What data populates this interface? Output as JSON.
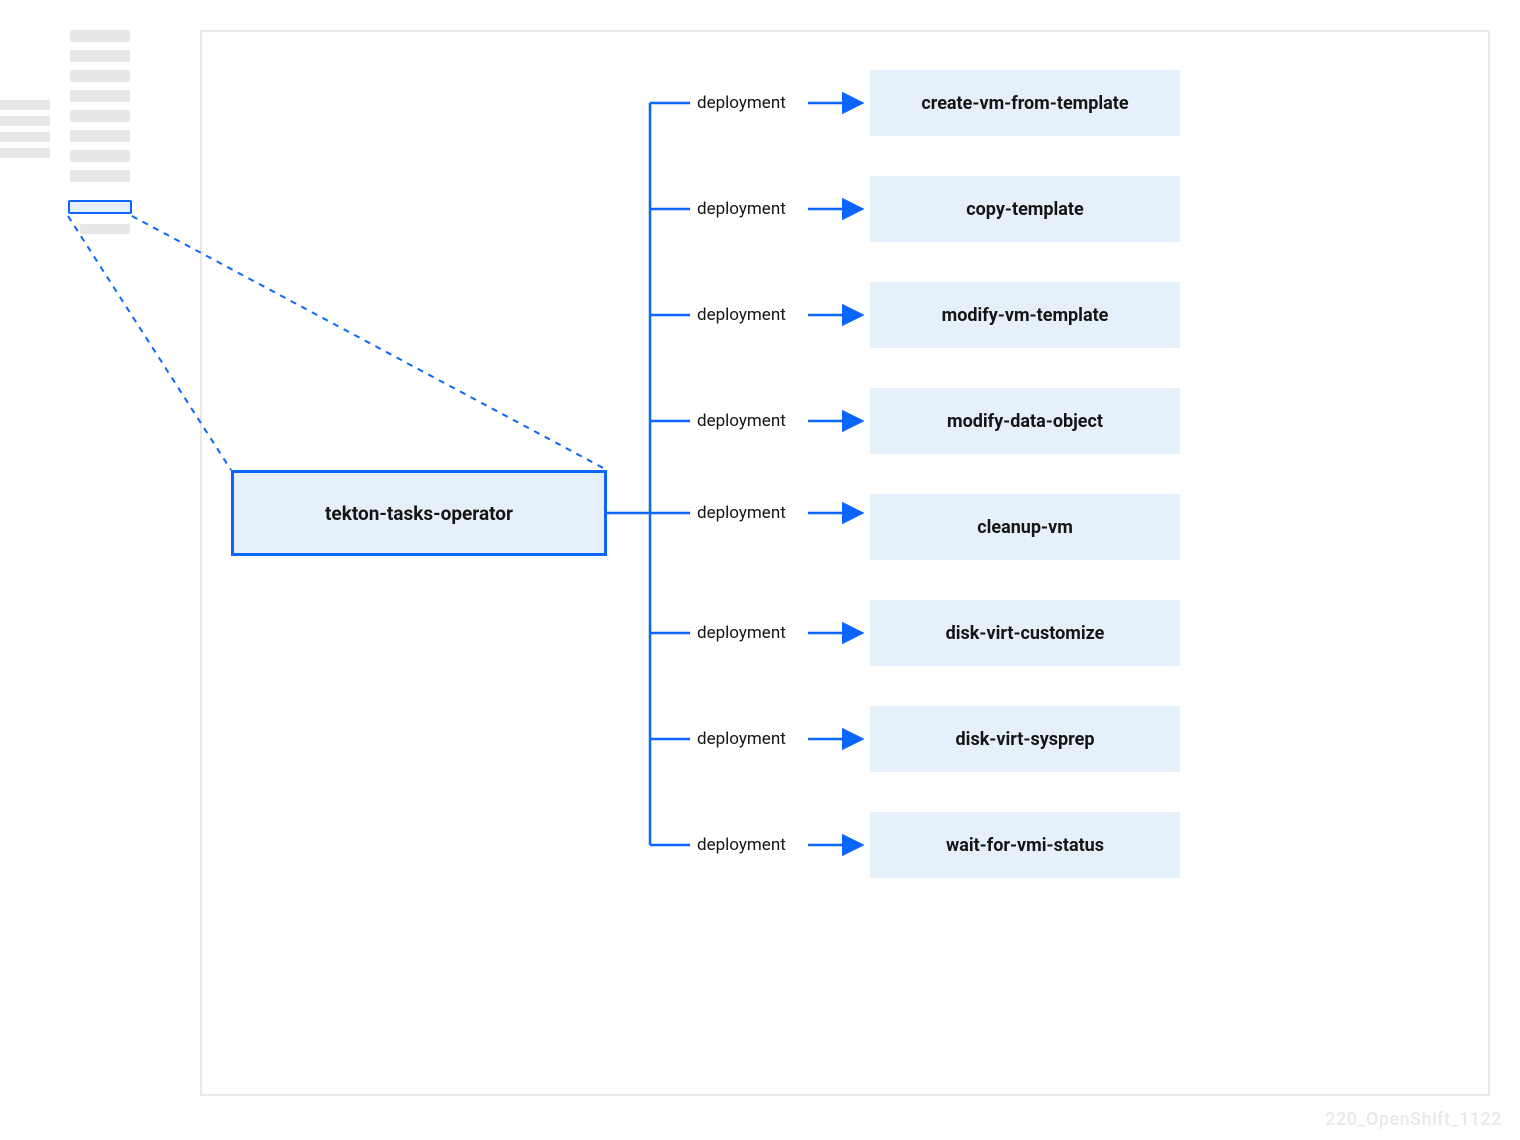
{
  "operator": {
    "label": "tekton-tasks-operator"
  },
  "edge_label": "deployment",
  "tasks": [
    {
      "name": "create-vm-from-template"
    },
    {
      "name": "copy-template"
    },
    {
      "name": "modify-vm-template"
    },
    {
      "name": "modify-data-object"
    },
    {
      "name": "cleanup-vm"
    },
    {
      "name": "disk-virt-customize"
    },
    {
      "name": "disk-virt-sysprep"
    },
    {
      "name": "wait-for-vmi-status"
    }
  ],
  "watermark": "220_OpenShift_1122",
  "colors": {
    "accent": "#0a66ff",
    "fill": "#e6f0fb",
    "frame": "#eaeaea"
  },
  "chart_data": {
    "type": "tree",
    "root": "tekton-tasks-operator",
    "edge_relation": "deployment",
    "children": [
      "create-vm-from-template",
      "copy-template",
      "modify-vm-template",
      "modify-data-object",
      "cleanup-vm",
      "disk-virt-customize",
      "disk-virt-sysprep",
      "wait-for-vmi-status"
    ]
  }
}
